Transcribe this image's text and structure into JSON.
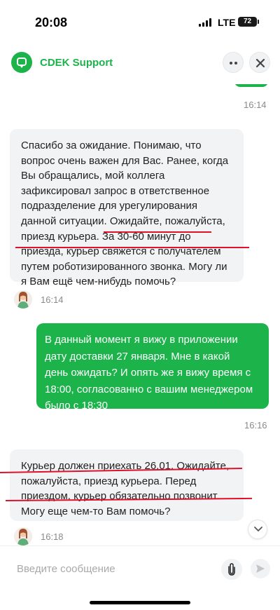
{
  "status_bar": {
    "time": "20:08",
    "network": "LTE",
    "battery": "72"
  },
  "header": {
    "title": "CDEK Support"
  },
  "messages": [
    {
      "type": "outgoing-partial",
      "time": "16:14"
    },
    {
      "type": "incoming",
      "lines": [
        "Спасибо за ожидание. Понимаю, что",
        "вопрос очень важен для Вас. Ранее, когда",
        "Вы обращались, мой коллега",
        "зафиксировал запрос в ответственное",
        "подразделение для урегулирования",
        "данной ситуации. Ожидайте, пожалуйста,",
        "приезд курьера. За 30-60 минут до",
        "приезда, курьер свяжется с получателем",
        "путем роботизированного звонка. Могу ли",
        "я Вам ещё чем-нибудь помочь?"
      ],
      "time": "16:14"
    },
    {
      "type": "outgoing",
      "lines": [
        "В данный момент я вижу в приложении",
        "дату доставки 27 января. Мне в какой",
        "день ожидать? И опять же я вижу время с",
        "18:00, согласованно с вашим менеджером",
        "было с 18:30"
      ],
      "time": "16:16"
    },
    {
      "type": "incoming",
      "lines": [
        "Курьер должен приехать 26.01. Ожидайте,",
        "пожалуйста, приезд курьера. Перед",
        "приездом, курьер обязательно позвонит.",
        "Могу еще чем-то Вам помочь?"
      ],
      "time": "16:18"
    }
  ],
  "composer": {
    "placeholder": "Введите сообщение"
  },
  "colors": {
    "accent": "#1bb34a",
    "annotation": "#e0112b",
    "incoming_bubble": "#f2f3f5"
  },
  "icons": [
    "chat-logo-icon",
    "more-icon",
    "close-icon",
    "avatar-icon",
    "chevron-down-icon",
    "attach-icon",
    "send-icon"
  ]
}
